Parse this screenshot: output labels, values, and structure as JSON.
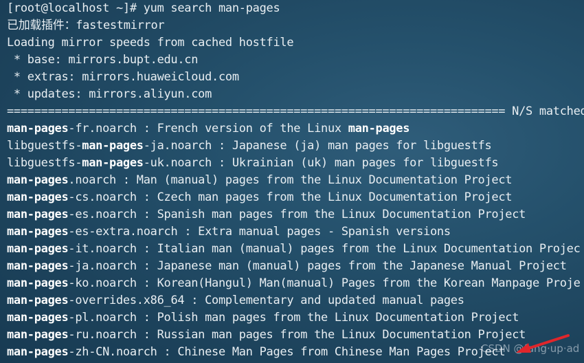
{
  "terminal": {
    "prompt": "[root@localhost ~]# yum search man-pages",
    "plugins": "已加载插件：fastestmirror",
    "loading": "Loading mirror speeds from cached hostfile",
    "mirrors": [
      " * base: mirrors.bupt.edu.cn",
      " * extras: mirrors.huaweicloud.com",
      " * updates: mirrors.aliyun.com"
    ],
    "separator": "========================================================================= N/S matched",
    "results": [
      {
        "pre": "",
        "hl": "man-pages",
        "post": "-fr.noarch : French version of the Linux ",
        "hl2": "man-pages"
      },
      {
        "pre": "libguestfs-",
        "hl": "man-pages",
        "post": "-ja.noarch : Japanese (ja) man pages for libguestfs",
        "hl2": ""
      },
      {
        "pre": "libguestfs-",
        "hl": "man-pages",
        "post": "-uk.noarch : Ukrainian (uk) man pages for libguestfs",
        "hl2": ""
      },
      {
        "pre": "",
        "hl": "man-pages",
        "post": ".noarch : Man (manual) pages from the Linux Documentation Project",
        "hl2": ""
      },
      {
        "pre": "",
        "hl": "man-pages",
        "post": "-cs.noarch : Czech man pages from the Linux Documentation Project",
        "hl2": ""
      },
      {
        "pre": "",
        "hl": "man-pages",
        "post": "-es.noarch : Spanish man pages from the Linux Documentation Project",
        "hl2": ""
      },
      {
        "pre": "",
        "hl": "man-pages",
        "post": "-es-extra.noarch : Extra manual pages - Spanish versions",
        "hl2": ""
      },
      {
        "pre": "",
        "hl": "man-pages",
        "post": "-it.noarch : Italian man (manual) pages from the Linux Documentation Projec",
        "hl2": ""
      },
      {
        "pre": "",
        "hl": "man-pages",
        "post": "-ja.noarch : Japanese man (manual) pages from the Japanese Manual Project",
        "hl2": ""
      },
      {
        "pre": "",
        "hl": "man-pages",
        "post": "-ko.noarch : Korean(Hangul) Man(manual) Pages from the Korean Manpage Proje",
        "hl2": ""
      },
      {
        "pre": "",
        "hl": "man-pages",
        "post": "-overrides.x86_64 : Complementary and updated manual pages",
        "hl2": ""
      },
      {
        "pre": "",
        "hl": "man-pages",
        "post": "-pl.noarch : Polish man pages from the Linux Documentation Project",
        "hl2": ""
      },
      {
        "pre": "",
        "hl": "man-pages",
        "post": "-ru.noarch : Russian man pages from the Linux Documentation Project",
        "hl2": ""
      },
      {
        "pre": "",
        "hl": "man-pages",
        "post": "-zh-CN.noarch : Chinese Man Pages from Chinese Man Pages Project",
        "hl2": ""
      }
    ]
  },
  "watermark": "CSDN @fang·up·ad",
  "colors": {
    "text": "#e8eef2",
    "highlight": "#ffffff",
    "arrow": "#e0262b"
  }
}
